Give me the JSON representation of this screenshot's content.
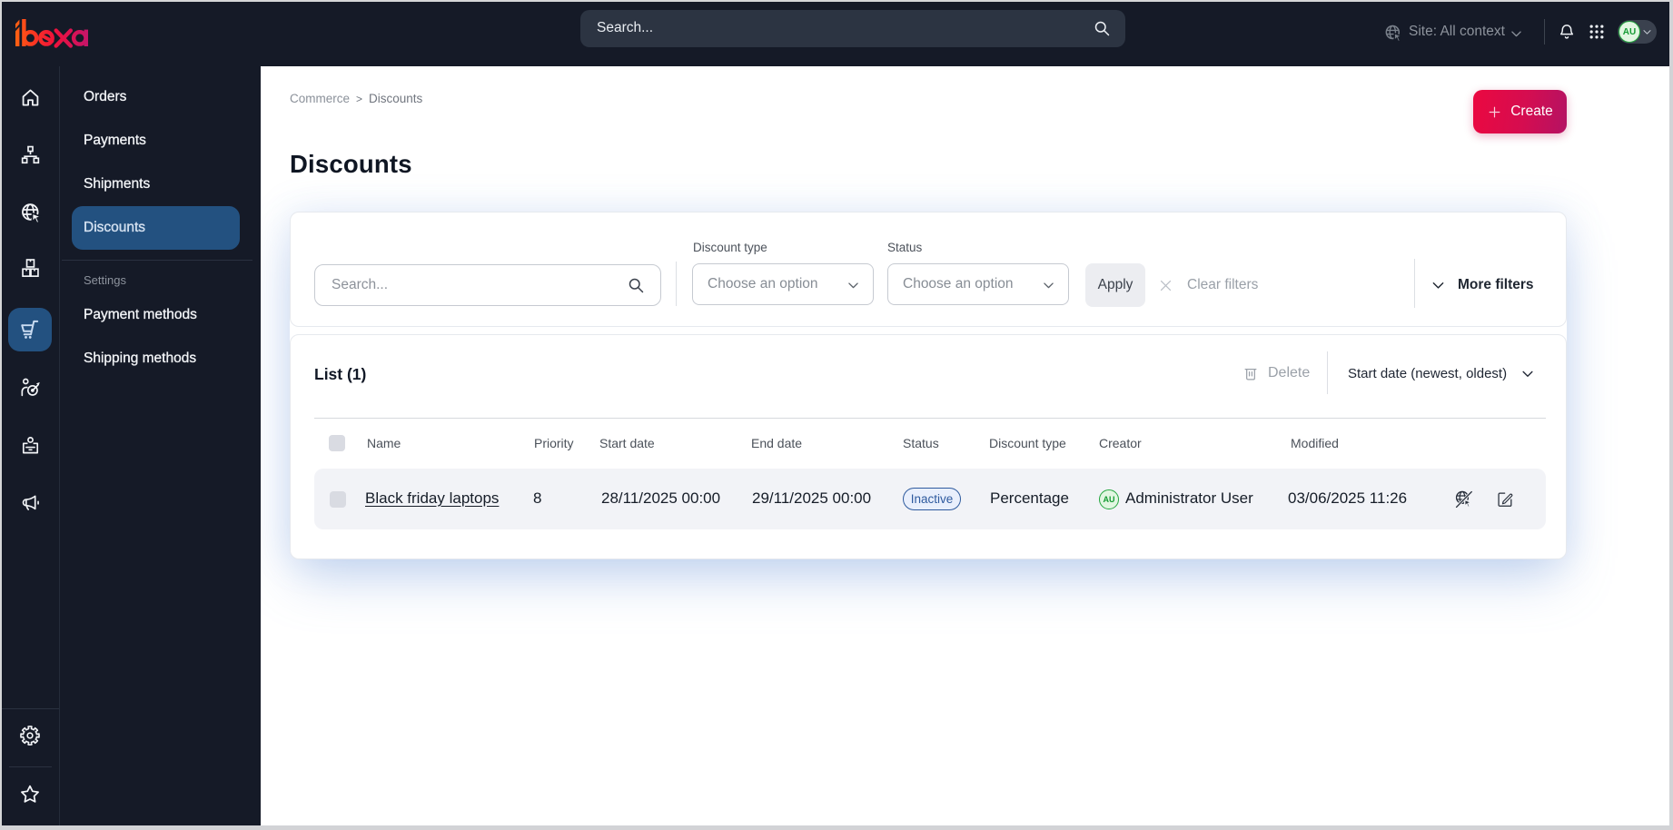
{
  "topbar": {
    "logo": "ibexa",
    "search_placeholder": "Search...",
    "site_context": "Site: All context",
    "avatar_initials": "AU"
  },
  "rail_items": [
    {
      "name": "home"
    },
    {
      "name": "content-structure"
    },
    {
      "name": "site"
    },
    {
      "name": "product-catalog"
    },
    {
      "name": "commerce",
      "active": true
    },
    {
      "name": "customers"
    },
    {
      "name": "corporate"
    },
    {
      "name": "marketing"
    },
    {
      "name": "settings"
    },
    {
      "name": "bookmarks"
    }
  ],
  "panel": {
    "items": [
      {
        "label": "Orders"
      },
      {
        "label": "Payments"
      },
      {
        "label": "Shipments"
      },
      {
        "label": "Discounts",
        "active": true
      }
    ],
    "section_label": "Settings",
    "settings_items": [
      {
        "label": "Payment methods"
      },
      {
        "label": "Shipping methods"
      }
    ]
  },
  "breadcrumb": {
    "root": "Commerce",
    "separator": ">",
    "current": "Discounts"
  },
  "header": {
    "title": "Discounts",
    "create_label": "Create"
  },
  "filters": {
    "search_placeholder": "Search...",
    "discount_type_label": "Discount type",
    "discount_type_value": "Choose an option",
    "status_label": "Status",
    "status_value": "Choose an option",
    "apply_label": "Apply",
    "clear_label": "Clear filters",
    "more_label": "More filters"
  },
  "list": {
    "title": "List (1)",
    "delete_label": "Delete",
    "sort_label": "Start date (newest, oldest)",
    "columns": [
      "Name",
      "Priority",
      "Start date",
      "End date",
      "Status",
      "Discount type",
      "Creator",
      "Modified"
    ],
    "row": {
      "name": "Black friday laptops",
      "priority": "8",
      "start_date": "28/11/2025 00:00",
      "end_date": "29/11/2025 00:00",
      "status": "Inactive",
      "discount_type": "Percentage",
      "creator_initials": "AU",
      "creator": "Administrator User",
      "modified": "03/06/2025 11:26"
    }
  },
  "colors": {
    "topbar_bg": "#151a27",
    "active_blue": "#235180",
    "brand_gradient_start": "#eb0840",
    "brand_gradient_end": "#b41263",
    "status_inactive": "#2e5a9e",
    "avatar_green": "#23a63e"
  }
}
